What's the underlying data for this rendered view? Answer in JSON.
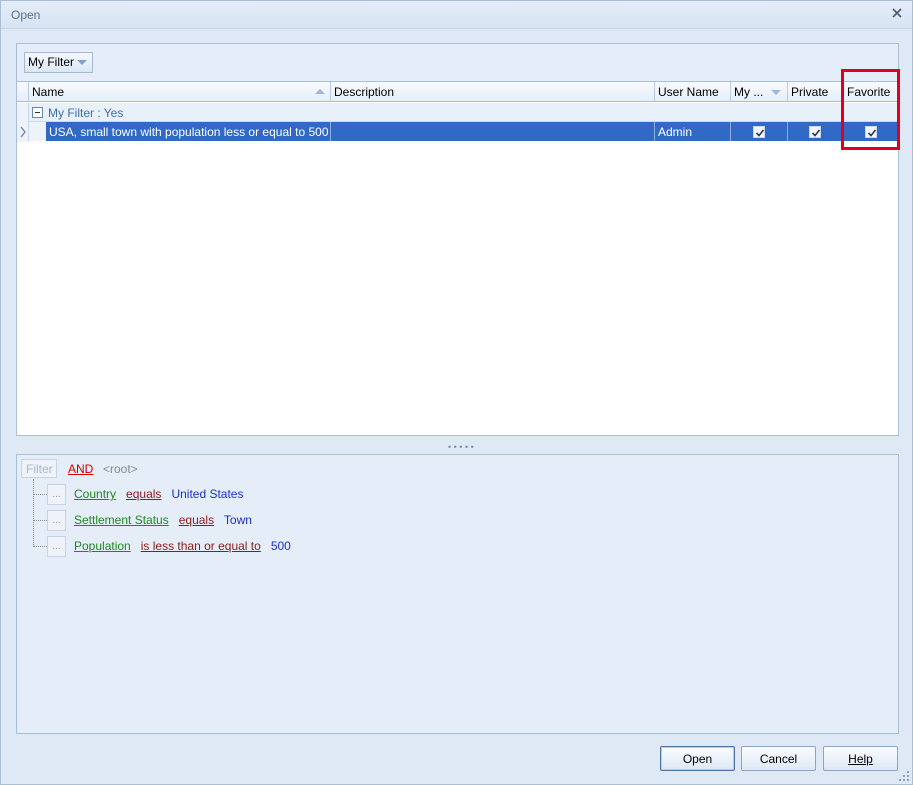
{
  "window": {
    "title": "Open"
  },
  "toolbar": {
    "my_filter_label": "My Filter"
  },
  "grid": {
    "columns": [
      {
        "key": "name",
        "label": "Name"
      },
      {
        "key": "description",
        "label": "Description"
      },
      {
        "key": "user_name",
        "label": "User Name"
      },
      {
        "key": "my",
        "label": "My ..."
      },
      {
        "key": "private",
        "label": "Private"
      },
      {
        "key": "favorite",
        "label": "Favorite"
      }
    ],
    "group_label": "My Filter : Yes",
    "rows": [
      {
        "name": "USA, small town with population less or equal to 500",
        "description": "",
        "user_name": "Admin",
        "my": true,
        "private": true,
        "favorite": true
      }
    ]
  },
  "filter": {
    "button_label": "Filter",
    "group_op": "AND",
    "root_label": "<root>",
    "dots_label": "...",
    "conditions": [
      {
        "field": "Country",
        "op": "equals",
        "value": "United States"
      },
      {
        "field": "Settlement Status",
        "op": "equals",
        "value": "Town"
      },
      {
        "field": "Population",
        "op": "is less than or equal to",
        "value": "500"
      }
    ]
  },
  "buttons": {
    "open": "Open",
    "cancel": "Cancel",
    "help": "Help"
  },
  "colors": {
    "selection": "#3169c6",
    "highlight": "#e0001b",
    "field": "#1d8a1d",
    "operator": "#8b1a1a",
    "value": "#1b33c2",
    "group_op": "#d40000"
  }
}
